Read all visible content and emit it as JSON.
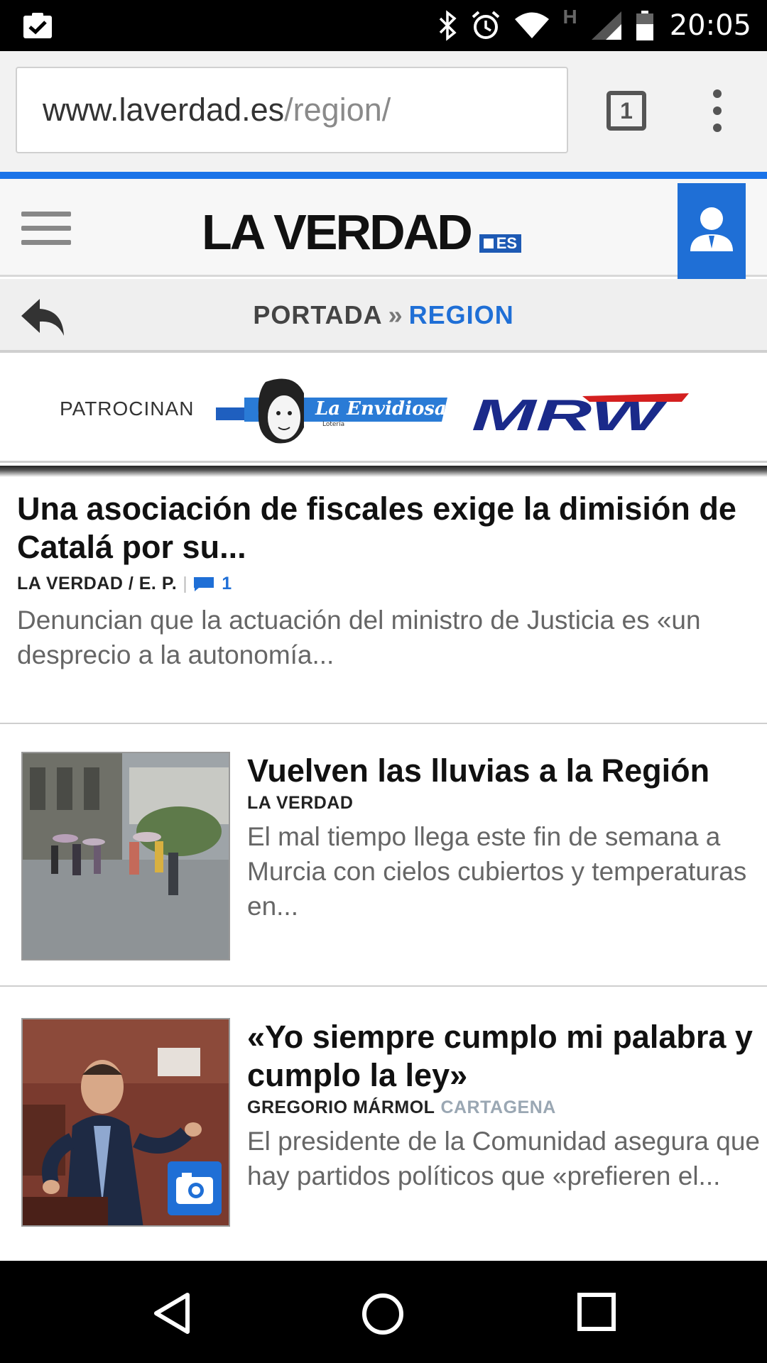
{
  "status_bar": {
    "time": "20:05",
    "network_type": "H",
    "icons": [
      "clipboard-check-icon",
      "bluetooth-icon",
      "alarm-icon",
      "wifi-icon",
      "signal-icon",
      "battery-icon"
    ]
  },
  "browser": {
    "url_domain": "www.laverdad.es",
    "url_path": "/region/",
    "tab_count": "1",
    "progress_color": "#1a73e8"
  },
  "site": {
    "logo_text": "LA VERDAD",
    "logo_suffix": "ES",
    "accent_color": "#1f6fd6"
  },
  "breadcrumb": {
    "home": "PORTADA",
    "separator": "»",
    "current": "REGION"
  },
  "sponsors": {
    "label": "PATROCINAN",
    "envidiosa_name": "La Envidiosa",
    "envidiosa_sub": "Lotería",
    "mrw_name": "MRW"
  },
  "articles": [
    {
      "headline": "Una asociación de fiscales exige la dimisión de Catalá por su...",
      "author": "LA VERDAD / E. P.",
      "pipe": "|",
      "comments": "1",
      "summary": "Denuncian que la actuación del ministro de Justicia es «un desprecio a la autonomía..."
    },
    {
      "headline": "Vuelven las lluvias a la Región",
      "author": "LA VERDAD",
      "summary": "El mal tiempo llega este fin de semana a Murcia con cielos cubiertos y temperaturas en..."
    },
    {
      "headline": "«Yo siempre cumplo mi palabra y cumplo la ley»",
      "author": "GREGORIO MÁRMOL",
      "tag": "CARTAGENA",
      "summary": "El presidente de la Comunidad asegura que hay partidos políticos que «prefieren el..."
    }
  ]
}
